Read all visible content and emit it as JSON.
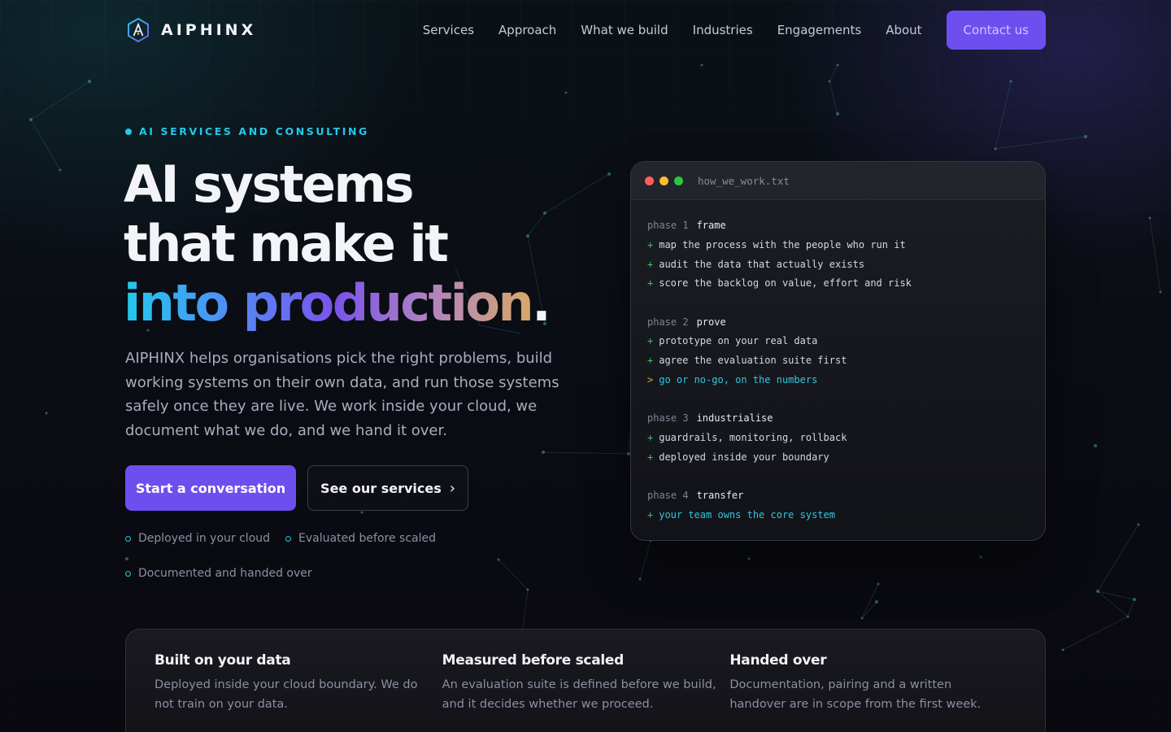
{
  "brand": {
    "name": "AIPHINX",
    "logo_icon": "hexagon-a-logo-icon"
  },
  "nav": {
    "links": [
      "Services",
      "Approach",
      "What we build",
      "Industries",
      "Engagements",
      "About"
    ],
    "contact_label": "Contact us"
  },
  "hero": {
    "eyebrow": "AI SERVICES AND CONSULTING",
    "headline_line1": "AI systems",
    "headline_line2": "that make it",
    "headline_line3": "into production",
    "headline_period": ".",
    "intro": "AIPHINX helps organisations pick the right problems, build working systems on their own data, and run those systems safely once they are live. We work inside your cloud, we document what we do, and we hand it over.",
    "primary_cta": "Start a conversation",
    "secondary_cta": "See our services",
    "secondary_cta_icon": "chevron-right-icon",
    "features": [
      "Deployed in your cloud",
      "Evaluated before scaled",
      "Documented and handed over"
    ]
  },
  "terminal": {
    "filename": "how_we_work.txt",
    "window_dots": [
      "#ff5f57",
      "#febc2e",
      "#28c840"
    ],
    "phases": [
      {
        "label": "phase 1",
        "name": "frame",
        "lines": [
          {
            "marker": "+",
            "text": "map the process with the people who run it"
          },
          {
            "marker": "+",
            "text": "audit the data that actually exists"
          },
          {
            "marker": "+",
            "text": "score the backlog on value, effort and risk"
          }
        ]
      },
      {
        "label": "phase 2",
        "name": "prove",
        "lines": [
          {
            "marker": "+",
            "text": "prototype on your real data"
          },
          {
            "marker": "+",
            "text": "agree the evaluation suite first"
          },
          {
            "marker": ">",
            "text": "go or no-go, on the numbers"
          }
        ]
      },
      {
        "label": "phase 3",
        "name": "industrialise",
        "lines": [
          {
            "marker": "+",
            "text": "guardrails, monitoring, rollback"
          },
          {
            "marker": "+",
            "text": "deployed inside your boundary"
          }
        ]
      },
      {
        "label": "phase 4",
        "name": "transfer",
        "lines": [
          {
            "marker": "+",
            "text": "your team owns the core system"
          }
        ]
      }
    ]
  },
  "strip": [
    {
      "title": "Built on your data",
      "text": "Deployed inside your cloud boundary. We do not train on your data."
    },
    {
      "title": "Measured before scaled",
      "text": "An evaluation suite is defined before we build, and it decides whether we proceed."
    },
    {
      "title": "Handed over",
      "text": "Documentation, pairing and a written handover are in scope from the first week."
    }
  ],
  "colors": {
    "accent": "#6d4ff0",
    "cyan": "#22c9e8",
    "plus_marker": "#39c46e",
    "arrow_marker": "#e3a33b"
  }
}
